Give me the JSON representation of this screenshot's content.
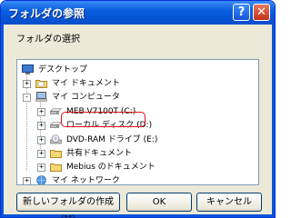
{
  "window": {
    "title": "フォルダの参照"
  },
  "instruction": "フォルダの選択",
  "tree": {
    "items": [
      {
        "label": "デスクトップ",
        "icon": "desktop-icon",
        "expander": ""
      },
      {
        "label": "マイ ドキュメント",
        "icon": "folder-icon",
        "expander": "+"
      },
      {
        "label": "マイ コンピュータ",
        "icon": "computer-icon",
        "expander": "-"
      },
      {
        "label": "MEB V7100T (C:)",
        "icon": "hard-drive-icon",
        "expander": "+"
      },
      {
        "label": "ローカル ディスク (D:)",
        "icon": "hard-drive-icon",
        "expander": "+",
        "selected": true
      },
      {
        "label": "DVD-RAM ドライブ (E:)",
        "icon": "dvd-drive-icon",
        "expander": "+"
      },
      {
        "label": "共有ドキュメント",
        "icon": "folder-icon",
        "expander": "+"
      },
      {
        "label": "Mebius のドキュメント",
        "icon": "folder-icon",
        "expander": "+"
      },
      {
        "label": "マイ ネットワーク",
        "icon": "network-icon",
        "expander": "+"
      }
    ]
  },
  "buttons": {
    "new_folder": "新しいフォルダの作成(M)",
    "ok": "OK",
    "cancel": "キャンセル"
  },
  "colors": {
    "highlight": "#e0101a",
    "titlebar": "#0a5fe0"
  }
}
